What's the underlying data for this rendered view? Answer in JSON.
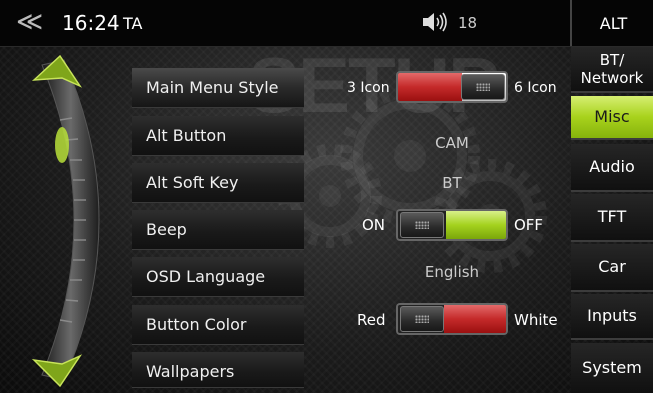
{
  "topbar": {
    "back_icon": "chevron-double-left-icon",
    "time": "16:24",
    "source": "TA",
    "volume_icon": "speaker-icon",
    "volume": "18",
    "alt_label": "ALT"
  },
  "watermark": "SETUP",
  "menu": {
    "items": [
      {
        "label": "Main Menu Style",
        "active": true
      },
      {
        "label": "Alt Button"
      },
      {
        "label": "Alt Soft Key"
      },
      {
        "label": "Beep"
      },
      {
        "label": "OSD Language"
      },
      {
        "label": "Button Color"
      },
      {
        "label": "Wallpapers"
      }
    ]
  },
  "settings": {
    "main_menu_style": {
      "left_label": "3 Icon",
      "right_label": "6 Icon",
      "selected": "3 Icon"
    },
    "alt_button": "CAM",
    "alt_soft_key": "BT",
    "beep": {
      "left_label": "ON",
      "right_label": "OFF",
      "selected": "ON"
    },
    "osd_language": "English",
    "button_color": {
      "left_label": "Red",
      "right_label": "White",
      "selected": "Red"
    }
  },
  "tabs": [
    {
      "label": "BT/\nNetwork"
    },
    {
      "label": "Misc",
      "active": true
    },
    {
      "label": "Audio"
    },
    {
      "label": "TFT"
    },
    {
      "label": "Car"
    },
    {
      "label": "Inputs"
    },
    {
      "label": "System"
    }
  ],
  "colors": {
    "accent_green": "#a8d21c",
    "toggle_red": "#c42a2a"
  }
}
